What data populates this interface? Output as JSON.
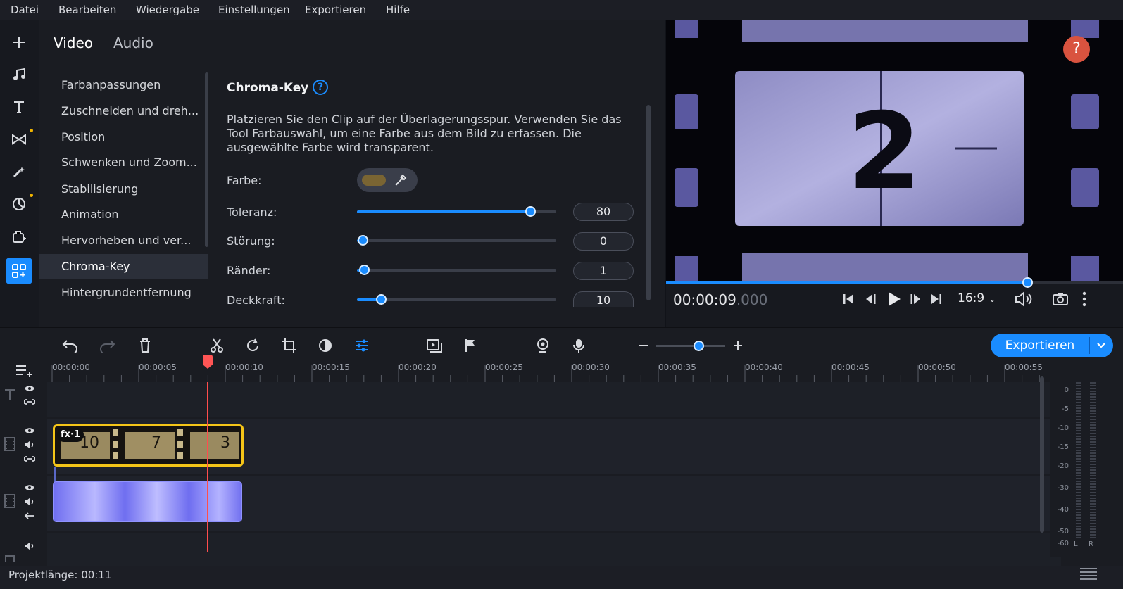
{
  "menu": [
    "Datei",
    "Bearbeiten",
    "Wiedergabe",
    "Einstellungen",
    "Exportieren",
    "Hilfe"
  ],
  "tabs": {
    "video": "Video",
    "audio": "Audio"
  },
  "side_list": [
    "Farbanpassungen",
    "Zuschneiden und dreh...",
    "Position",
    "Schwenken und Zoom...",
    "Stabilisierung",
    "Animation",
    "Hervorheben und ver...",
    "Chroma-Key",
    "Hintergrundentfernung"
  ],
  "settings": {
    "title": "Chroma-Key",
    "description_lines": [
      "Platzieren Sie den Clip auf der Überlagerungsspur. Verwenden Sie das",
      "Tool Farbauswahl, um eine Farbe aus dem Bild zu erfassen. Die",
      "ausgewählte Farbe wird transparent."
    ],
    "farbe_label": "Farbe:",
    "picked_color": "#7a6533",
    "sliders": [
      {
        "label": "Toleranz:",
        "value": "80",
        "fraction": 0.87
      },
      {
        "label": "Störung:",
        "value": "0",
        "fraction": 0.03
      },
      {
        "label": "Ränder:",
        "value": "1",
        "fraction": 0.035
      },
      {
        "label": "Deckkraft:",
        "value": "10",
        "fraction": 0.12
      }
    ]
  },
  "preview": {
    "frame_number": "2",
    "help": "?",
    "timecode_main": "00:00:09",
    "timecode_frac": ".000",
    "progress": 0.79,
    "aspect": "16:9"
  },
  "export_label": "Exportieren",
  "ruler_labels": [
    "00:00:00",
    "00:00:05",
    "00:00:10",
    "00:00:15",
    "00:00:20",
    "00:00:25",
    "00:00:30",
    "00:00:35",
    "00:00:40",
    "00:00:45",
    "00:00:50",
    "00:00:55"
  ],
  "clips": {
    "fx_badge": "fx·1",
    "countdown_numbers": [
      "10",
      "7",
      "3"
    ]
  },
  "meter_labels": [
    "0",
    "-5",
    "-10",
    "-15",
    "-20",
    "-30",
    "-40",
    "-50",
    "-60"
  ],
  "meter_channels": [
    "L",
    "R"
  ],
  "status": {
    "project_length": "Projektlänge: 00:11"
  },
  "colors": {
    "accent": "#1a8cff",
    "clip_selected_border": "#f5c518",
    "playhead": "#ff4d4d",
    "help_button": "#d9533f"
  }
}
